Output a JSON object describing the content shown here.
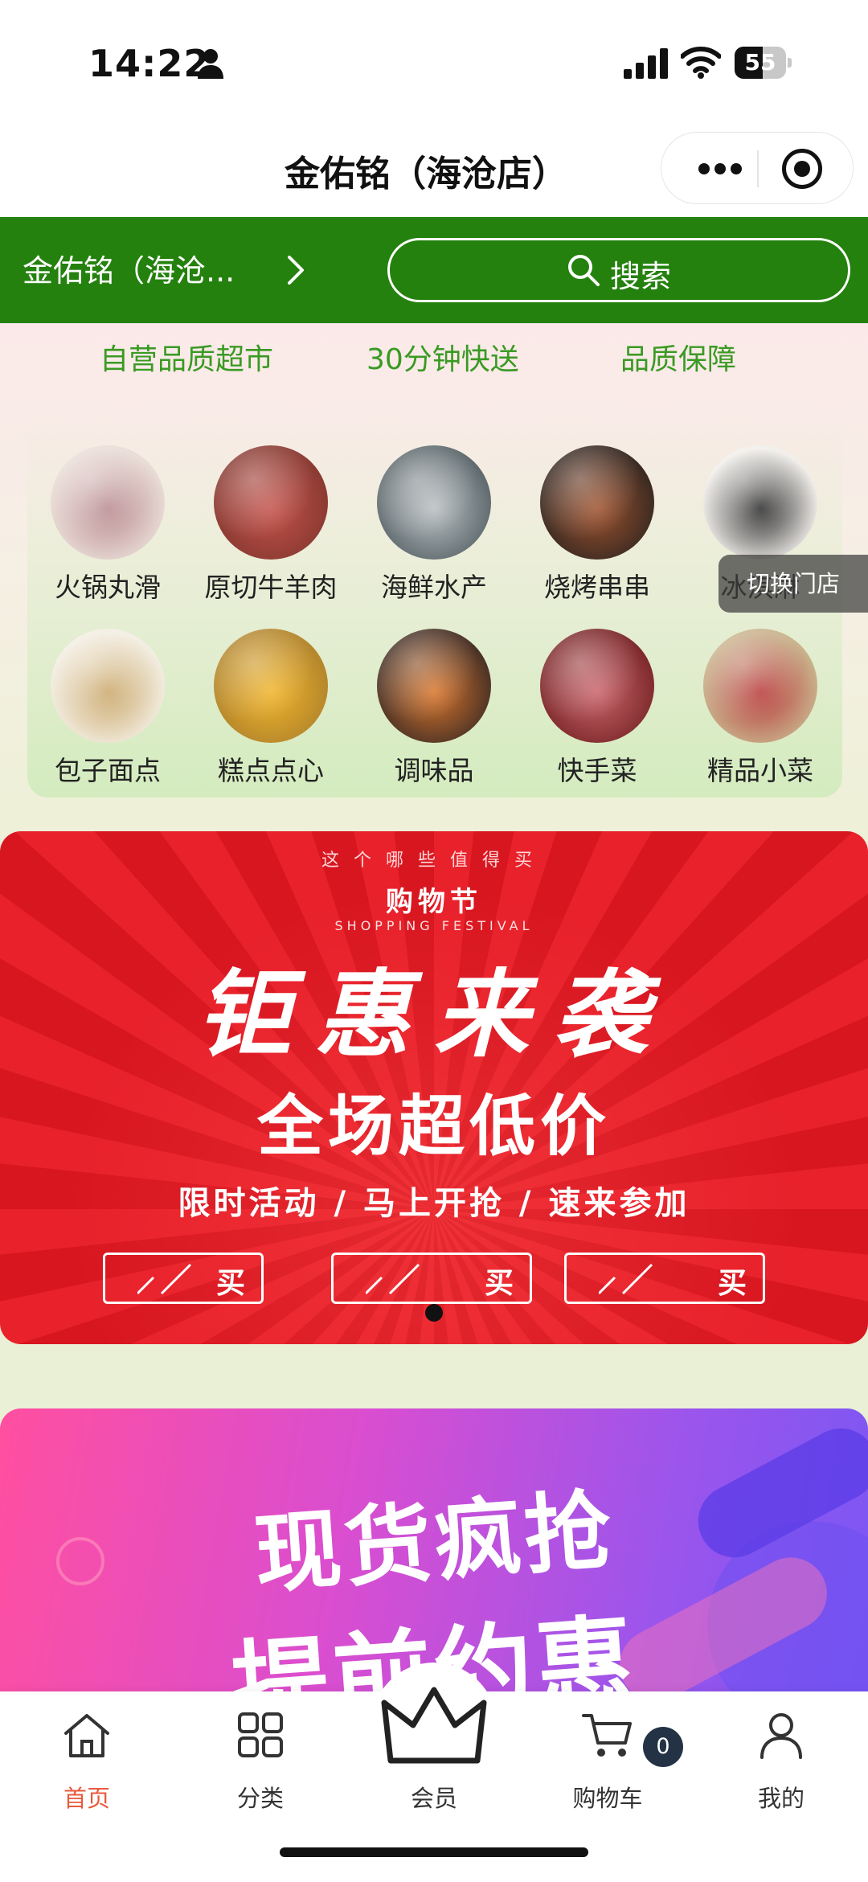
{
  "status_bar": {
    "time": "14:22",
    "battery": "55",
    "battery_level": 0.55
  },
  "nav": {
    "title": "金佑铭（海沧店）"
  },
  "store_bar": {
    "store_name": "金佑铭（海沧...",
    "search_label": "搜索"
  },
  "features": [
    "自营品质超市",
    "30分钟快送",
    "品质保障"
  ],
  "categories": [
    {
      "label": "火锅丸滑",
      "color": "#e9dcd6",
      "accent": "#b88a8f"
    },
    {
      "label": "原切牛羊肉",
      "color": "#8a3a32",
      "accent": "#c4524a"
    },
    {
      "label": "海鲜水产",
      "color": "#5f6a6e",
      "accent": "#b9c0c2"
    },
    {
      "label": "烧烤串串",
      "color": "#3a2a22",
      "accent": "#a0522d"
    },
    {
      "label": "冰淇淋",
      "color": "#f1eeea",
      "accent": "#2b2b2b"
    },
    {
      "label": "包子面点",
      "color": "#f3eee2",
      "accent": "#caa76a"
    },
    {
      "label": "糕点点心",
      "color": "#b4862c",
      "accent": "#f0b429"
    },
    {
      "label": "调味品",
      "color": "#4a3226",
      "accent": "#d9752a"
    },
    {
      "label": "快手菜",
      "color": "#7e2a2c",
      "accent": "#c9646a"
    },
    {
      "label": "精品小菜",
      "color": "#c9b28c",
      "accent": "#b83a3a"
    }
  ],
  "switch_store": "切换门店",
  "banner_red": {
    "top_line": "这个哪些值得买",
    "festival": "购物节",
    "festival_en": "SHOPPING FESTIVAL",
    "title": "钜惠来袭",
    "subtitle": "全场超低价",
    "line": "限时活动 / 马上开抢 / 速来参加",
    "buttons": [
      "买",
      "买",
      "买"
    ]
  },
  "banner_purple": {
    "title1": "现货疯抢",
    "title2": "提前约惠"
  },
  "tabs": [
    {
      "label": "首页",
      "icon": "home-icon",
      "active": true
    },
    {
      "label": "分类",
      "icon": "grid-icon",
      "active": false
    },
    {
      "label": "会员",
      "icon": "crown-icon",
      "active": false
    },
    {
      "label": "购物车",
      "icon": "cart-icon",
      "active": false
    },
    {
      "label": "我的",
      "icon": "user-icon",
      "active": false
    }
  ],
  "cart_count": "0",
  "colors": {
    "brand_green": "#24810e",
    "feature_green": "#3a9a23",
    "active_tab": "#e85a3c",
    "banner_red": "#e8212b"
  }
}
